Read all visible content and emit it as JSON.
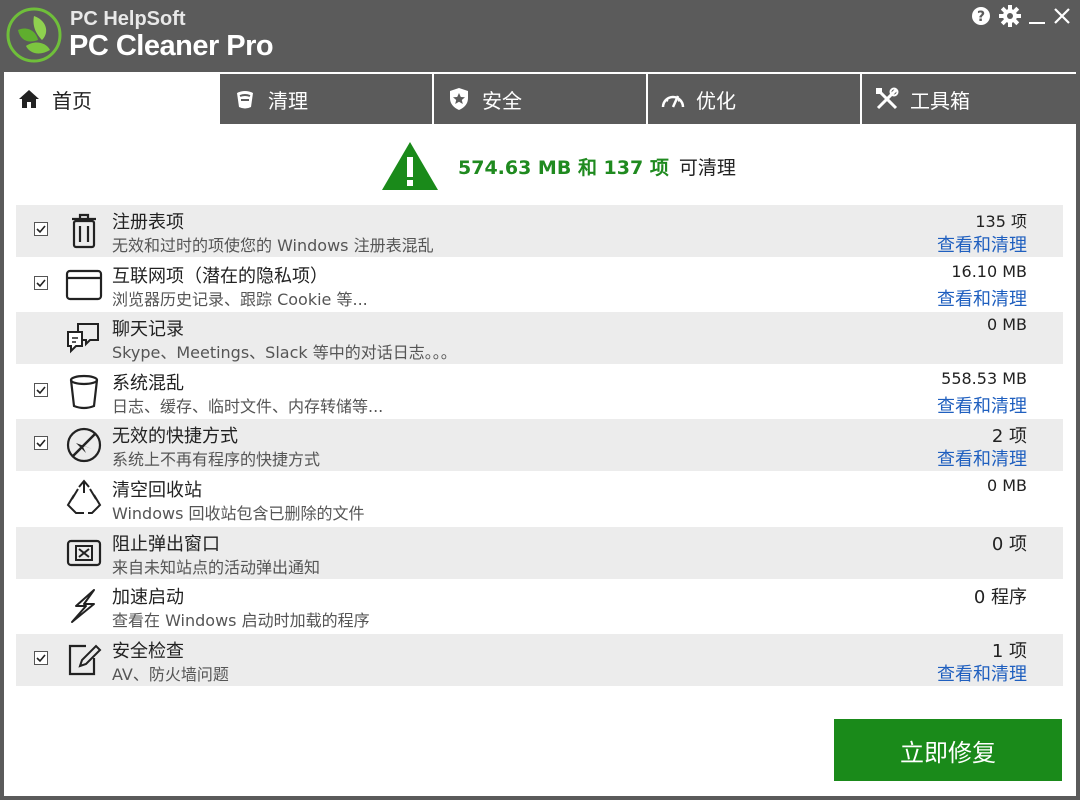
{
  "app": {
    "brand_top": "PC HelpSoft",
    "brand_main": "PC Cleaner Pro"
  },
  "window_controls": {
    "help": "help-icon",
    "settings": "gear-icon",
    "minimize": "minimize-icon",
    "close": "close-icon"
  },
  "tabs": [
    {
      "label": "首页",
      "icon": "home-icon",
      "active": true
    },
    {
      "label": "清理",
      "icon": "broom-icon",
      "active": false
    },
    {
      "label": "安全",
      "icon": "shield-icon",
      "active": false
    },
    {
      "label": "优化",
      "icon": "speedometer-icon",
      "active": false
    },
    {
      "label": "工具箱",
      "icon": "tools-icon",
      "active": false
    }
  ],
  "summary": {
    "amount": "574.63 MB 和 137 项",
    "suffix": "可清理",
    "icon": "warning-icon"
  },
  "items": [
    {
      "title": "注册表项",
      "desc": "无效和过时的项使您的 Windows 注册表混乱",
      "value": "135 项",
      "link": "查看和清理",
      "checked": true,
      "icon": "trash-icon"
    },
    {
      "title": "互联网项（潜在的隐私项）",
      "desc": "浏览器历史记录、跟踪 Cookie 等...",
      "value": "16.10 MB",
      "link": "查看和清理",
      "checked": true,
      "icon": "browser-window-icon"
    },
    {
      "title": "聊天记录",
      "desc": "Skype、Meetings、Slack 等中的对话日志。。。",
      "value": "0 MB",
      "link": "",
      "checked": false,
      "icon": "chat-bubbles-icon"
    },
    {
      "title": "系统混乱",
      "desc": "日志、缓存、临时文件、内存转储等...",
      "value": "558.53 MB",
      "link": "查看和清理",
      "checked": true,
      "icon": "bin-icon"
    },
    {
      "title": "无效的快捷方式",
      "desc": "系统上不再有程序的快捷方式",
      "value": "2 项",
      "link": "查看和清理",
      "checked": true,
      "icon": "broken-shortcut-icon"
    },
    {
      "title": "清空回收站",
      "desc": "Windows 回收站包含已删除的文件",
      "value": "0 MB",
      "link": "",
      "checked": false,
      "icon": "recycle-icon"
    },
    {
      "title": "阻止弹出窗口",
      "desc": "来自未知站点的活动弹出通知",
      "value": "0 项",
      "link": "",
      "checked": false,
      "icon": "popup-block-icon"
    },
    {
      "title": "加速启动",
      "desc": "查看在 Windows 启动时加载的程序",
      "value": "0 程序",
      "link": "",
      "checked": false,
      "icon": "lightning-icon"
    },
    {
      "title": "安全检查",
      "desc": "AV、防火墙问题",
      "value": "1 项",
      "link": "查看和清理",
      "checked": true,
      "icon": "edit-check-icon"
    }
  ],
  "fix_button": "立即修复",
  "colors": {
    "chrome": "#5b5b5b",
    "accent_green": "#1a8a1a",
    "link_blue": "#1f5fbf",
    "row_shade": "#ececec"
  }
}
